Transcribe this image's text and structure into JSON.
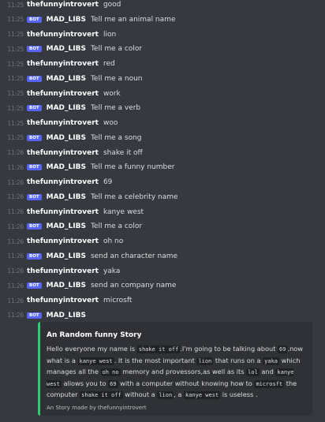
{
  "messages": [
    {
      "time": "11:25",
      "author": "thefunnyintrovert",
      "bot": false,
      "text": "good"
    },
    {
      "time": "11:25",
      "author": "MAD_LIBS",
      "bot": true,
      "text": "Tell me an animal name"
    },
    {
      "time": "11:25",
      "author": "thefunnyintrovert",
      "bot": false,
      "text": "lion"
    },
    {
      "time": "11:25",
      "author": "MAD_LIBS",
      "bot": true,
      "text": "Tell me a color"
    },
    {
      "time": "11:25",
      "author": "thefunnyintrovert",
      "bot": false,
      "text": "red"
    },
    {
      "time": "11:25",
      "author": "MAD_LIBS",
      "bot": true,
      "text": "Tell me a noun"
    },
    {
      "time": "11:25",
      "author": "thefunnyintrovert",
      "bot": false,
      "text": "work"
    },
    {
      "time": "11:25",
      "author": "MAD_LIBS",
      "bot": true,
      "text": "Tell me a verb"
    },
    {
      "time": "11:25",
      "author": "thefunnyintrovert",
      "bot": false,
      "text": "woo"
    },
    {
      "time": "11:25",
      "author": "MAD_LIBS",
      "bot": true,
      "text": "Tell me a song"
    },
    {
      "time": "11:26",
      "author": "thefunnyintrovert",
      "bot": false,
      "text": "shake it off"
    },
    {
      "time": "11:26",
      "author": "MAD_LIBS",
      "bot": true,
      "text": "Tell me a funny number"
    },
    {
      "time": "11:26",
      "author": "thefunnyintrovert",
      "bot": false,
      "text": "69"
    },
    {
      "time": "11:26",
      "author": "MAD_LIBS",
      "bot": true,
      "text": "Tell me a celebrity name"
    },
    {
      "time": "11:26",
      "author": "thefunnyintrovert",
      "bot": false,
      "text": "kanye west"
    },
    {
      "time": "11:26",
      "author": "MAD_LIBS",
      "bot": true,
      "text": "Tell me a color"
    },
    {
      "time": "11:26",
      "author": "thefunnyintrovert",
      "bot": false,
      "text": "oh no"
    },
    {
      "time": "11:26",
      "author": "MAD_LIBS",
      "bot": true,
      "text": "send an character name"
    },
    {
      "time": "11:26",
      "author": "thefunnyintrovert",
      "bot": false,
      "text": "yaka"
    },
    {
      "time": "11:26",
      "author": "MAD_LIBS",
      "bot": true,
      "text": "send an company name"
    },
    {
      "time": "11:26",
      "author": "thefunnyintrovert",
      "bot": false,
      "text": "microsft"
    },
    {
      "time": "11:26",
      "author": "MAD_LIBS",
      "bot": true,
      "text": ""
    }
  ],
  "bot_badge": "BOT",
  "embed": {
    "title": "An Random funny Story",
    "d1": "Hello everyone my name is",
    "c1": "shake it off",
    "d2": ".I'm going to be talking about",
    "c2": "69",
    "d3": ".now what is a",
    "c3": "kanye west",
    "d4": ". It is the most important",
    "c4": "lion",
    "d5": "that runs on a",
    "c5": "yaka",
    "d6": "which manages all the",
    "c6": "oh no",
    "d7": "memory and provessors,as well as its",
    "c7": "lol",
    "d8": "and",
    "c8": "kanye west",
    "d9": "allows you to",
    "c9": "69",
    "d10": "with a computer without knowing how to",
    "c10": "microsft",
    "d11": "the computer",
    "c11": "shake it off",
    "d12": "without a",
    "c12": "lion",
    "d13": ", a",
    "c13": "kanye west",
    "d14": "is useless .",
    "footer": "An Story made by thefunnyintrovert",
    "accent_color": "#2ecc71"
  },
  "colors": {
    "background": "#36393f",
    "embed_background": "#2f3136",
    "bot_badge": "#5865f2",
    "timestamp": "#72767d"
  }
}
